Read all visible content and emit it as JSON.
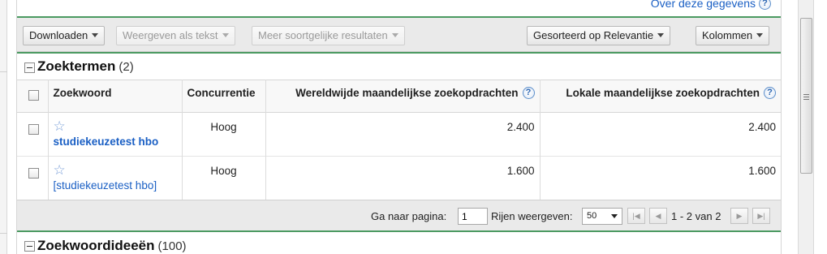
{
  "header": {
    "about_link": "Over deze gegevens",
    "help_icon": "question-icon"
  },
  "toolbar": {
    "downloaden": "Downloaden",
    "weergeven_als_tekst": "Weergeven als tekst",
    "meer_soortgelijke": "Meer soortgelijke resultaten",
    "gesorteerd": "Gesorteerd op Relevantie",
    "kolommen": "Kolommen"
  },
  "zoektermen": {
    "title": "Zoektermen",
    "count": "(2)",
    "columns": {
      "zoekwoord": "Zoekwoord",
      "concurrentie": "Concurrentie",
      "wereldwijd": "Wereldwijde maandelijkse zoekopdrachten",
      "lokaal": "Lokale maandelijkse zoekopdrachten"
    },
    "rows": [
      {
        "keyword": "studiekeuzetest hbo",
        "concurrentie": "Hoog",
        "wereldwijd": "2.400",
        "lokaal": "2.400"
      },
      {
        "keyword": "[studiekeuzetest hbo]",
        "concurrentie": "Hoog",
        "wereldwijd": "1.600",
        "lokaal": "1.600"
      }
    ]
  },
  "pager": {
    "ga_naar_pagina": "Ga naar pagina:",
    "page_value": "1",
    "rijen_weergeven": "Rijen weergeven:",
    "rows_value": "50",
    "range": "1 - 2 van 2"
  },
  "zoekwoordideeen": {
    "title": "Zoekwoordideeën",
    "count": "(100)"
  },
  "colors": {
    "accent_green": "#4b9a61",
    "link_blue": "#1a5fc4"
  }
}
